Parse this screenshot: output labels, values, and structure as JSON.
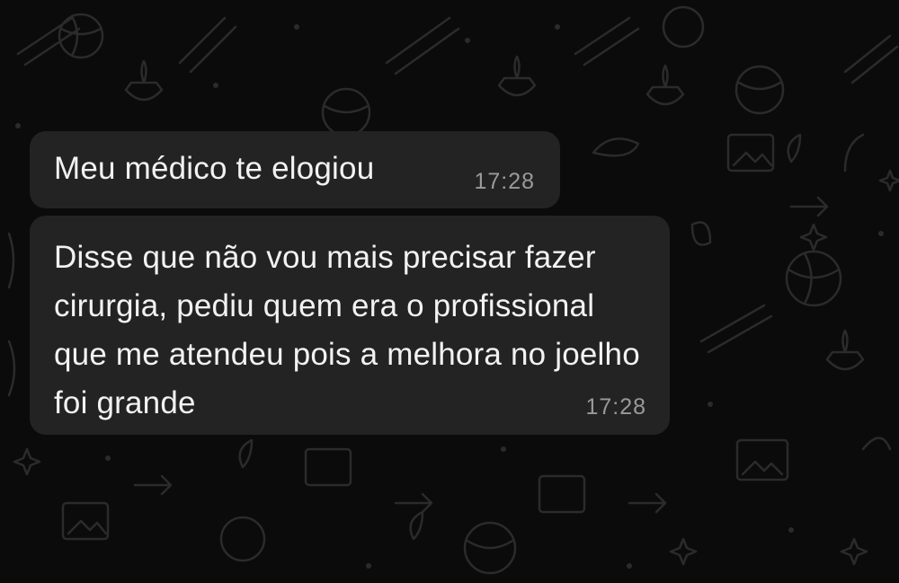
{
  "chat": {
    "background_color": "#0b0b0b",
    "bubble_color": "#232323",
    "messages": [
      {
        "text": "Meu médico te elogiou",
        "time": "17:28"
      },
      {
        "text": "Disse que não vou mais precisar fazer cirurgia, pediu quem era o profissional que me atendeu pois a melhora no joelho foi grande",
        "time": "17:28"
      }
    ]
  }
}
